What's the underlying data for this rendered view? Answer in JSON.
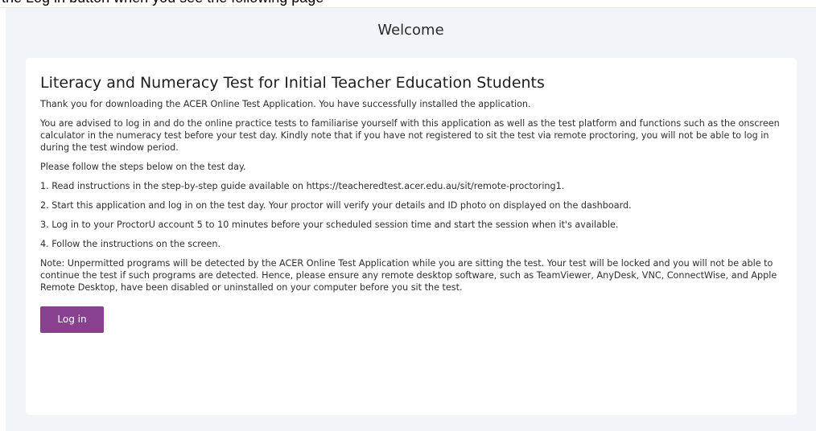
{
  "top_strip": {
    "text": "the Log in button when you see the following page"
  },
  "window": {
    "title": "Welcome"
  },
  "main": {
    "heading": "Literacy and Numeracy Test for Initial Teacher Education Students",
    "paragraphs": [
      "Thank you for downloading the ACER Online Test Application. You have successfully installed the application.",
      "You are advised to log in and do the online practice tests to familiarise yourself with this application as well as the test platform and functions such as the onscreen calculator in the numeracy test before your test day. Kindly note that if you have not registered to sit the test via remote proctoring, you will not be able to log in during the test window period.",
      "Please follow the steps below on the test day.",
      "1. Read instructions in the step-by-step guide available on https://teacheredtest.acer.edu.au/sit/remote-proctoring1.",
      "2. Start this application and log in on the test day. Your proctor will verify your details and ID photo on displayed on the dashboard.",
      "3. Log in to your ProctorU account 5 to 10 minutes before your scheduled session time and start the session when it's available.",
      "4. Follow the instructions on the screen.",
      "Note: Unpermitted programs will be detected by the ACER Online Test Application while you are sitting the test. Your test will be locked and you will not be able to continue the test if such programs are detected. Hence, please ensure any remote desktop software, such as TeamViewer, AnyDesk, VNC, ConnectWise, and Apple Remote Desktop, have been disabled or uninstalled on your computer before you sit the test."
    ],
    "login_label": "Log in"
  },
  "colors": {
    "button": "#88418e",
    "background": "#f1f5f9",
    "card": "#ffffff"
  }
}
